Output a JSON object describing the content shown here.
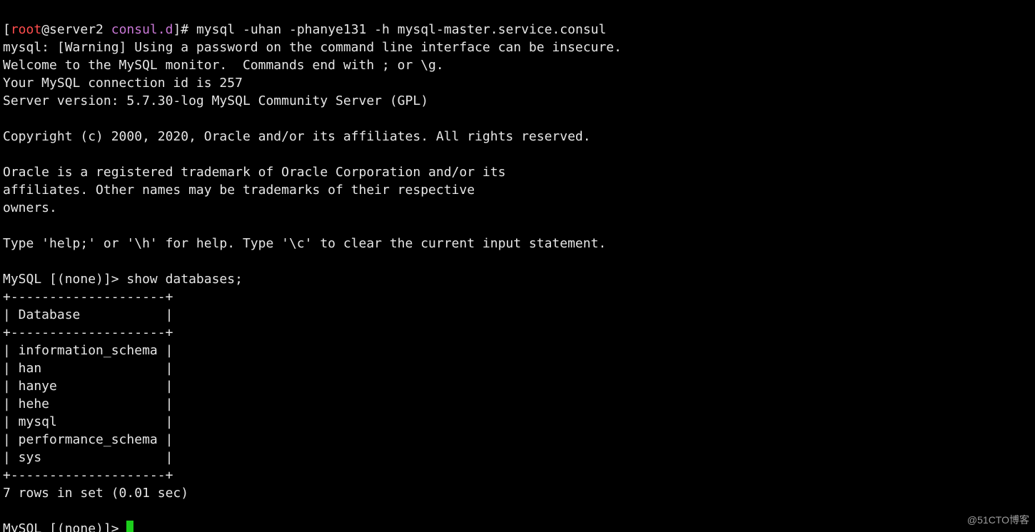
{
  "prompt1": {
    "bracket_open": "[",
    "user": "root",
    "at_host": "@server2 ",
    "path": "consul.d",
    "bracket_close_hash": "]# ",
    "command": "mysql -uhan -phanye131 -h mysql-master.service.consul"
  },
  "banner_lines": [
    "mysql: [Warning] Using a password on the command line interface can be insecure.",
    "Welcome to the MySQL monitor.  Commands end with ; or \\g.",
    "Your MySQL connection id is 257",
    "Server version: 5.7.30-log MySQL Community Server (GPL)",
    "",
    "Copyright (c) 2000, 2020, Oracle and/or its affiliates. All rights reserved.",
    "",
    "Oracle is a registered trademark of Oracle Corporation and/or its",
    "affiliates. Other names may be trademarks of their respective",
    "owners.",
    "",
    "Type 'help;' or '\\h' for help. Type '\\c' to clear the current input statement.",
    ""
  ],
  "mysql_prompt": "MySQL [(none)]> ",
  "query1": "show databases;",
  "table": {
    "border": "+--------------------+",
    "header": "| Database           |",
    "rows": [
      "| information_schema |",
      "| han                |",
      "| hanye              |",
      "| hehe               |",
      "| mysql              |",
      "| performance_schema |",
      "| sys                |"
    ]
  },
  "result_summary": "7 rows in set (0.01 sec)",
  "blank": "",
  "watermark": "@51CTO博客"
}
